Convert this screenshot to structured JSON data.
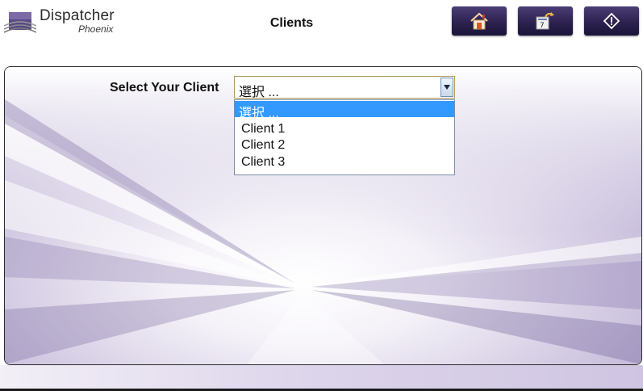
{
  "app": {
    "title": "Dispatcher",
    "subtitle": "Phoenix"
  },
  "page": {
    "title": "Clients"
  },
  "toolbar": {
    "buttons": [
      {
        "name": "home-button",
        "icon": "home-icon"
      },
      {
        "name": "job-settings-button",
        "icon": "card-reset-icon"
      },
      {
        "name": "info-button",
        "icon": "info-diamond-icon"
      }
    ]
  },
  "client_select": {
    "label": "Select Your Client",
    "value": "選択 ...",
    "options": [
      "選択 ...",
      "Client 1",
      "Client 2",
      "Client 3"
    ]
  },
  "colors": {
    "accent": "#2c2150",
    "selection": "#3399ff",
    "select_border": "#b09a55"
  }
}
